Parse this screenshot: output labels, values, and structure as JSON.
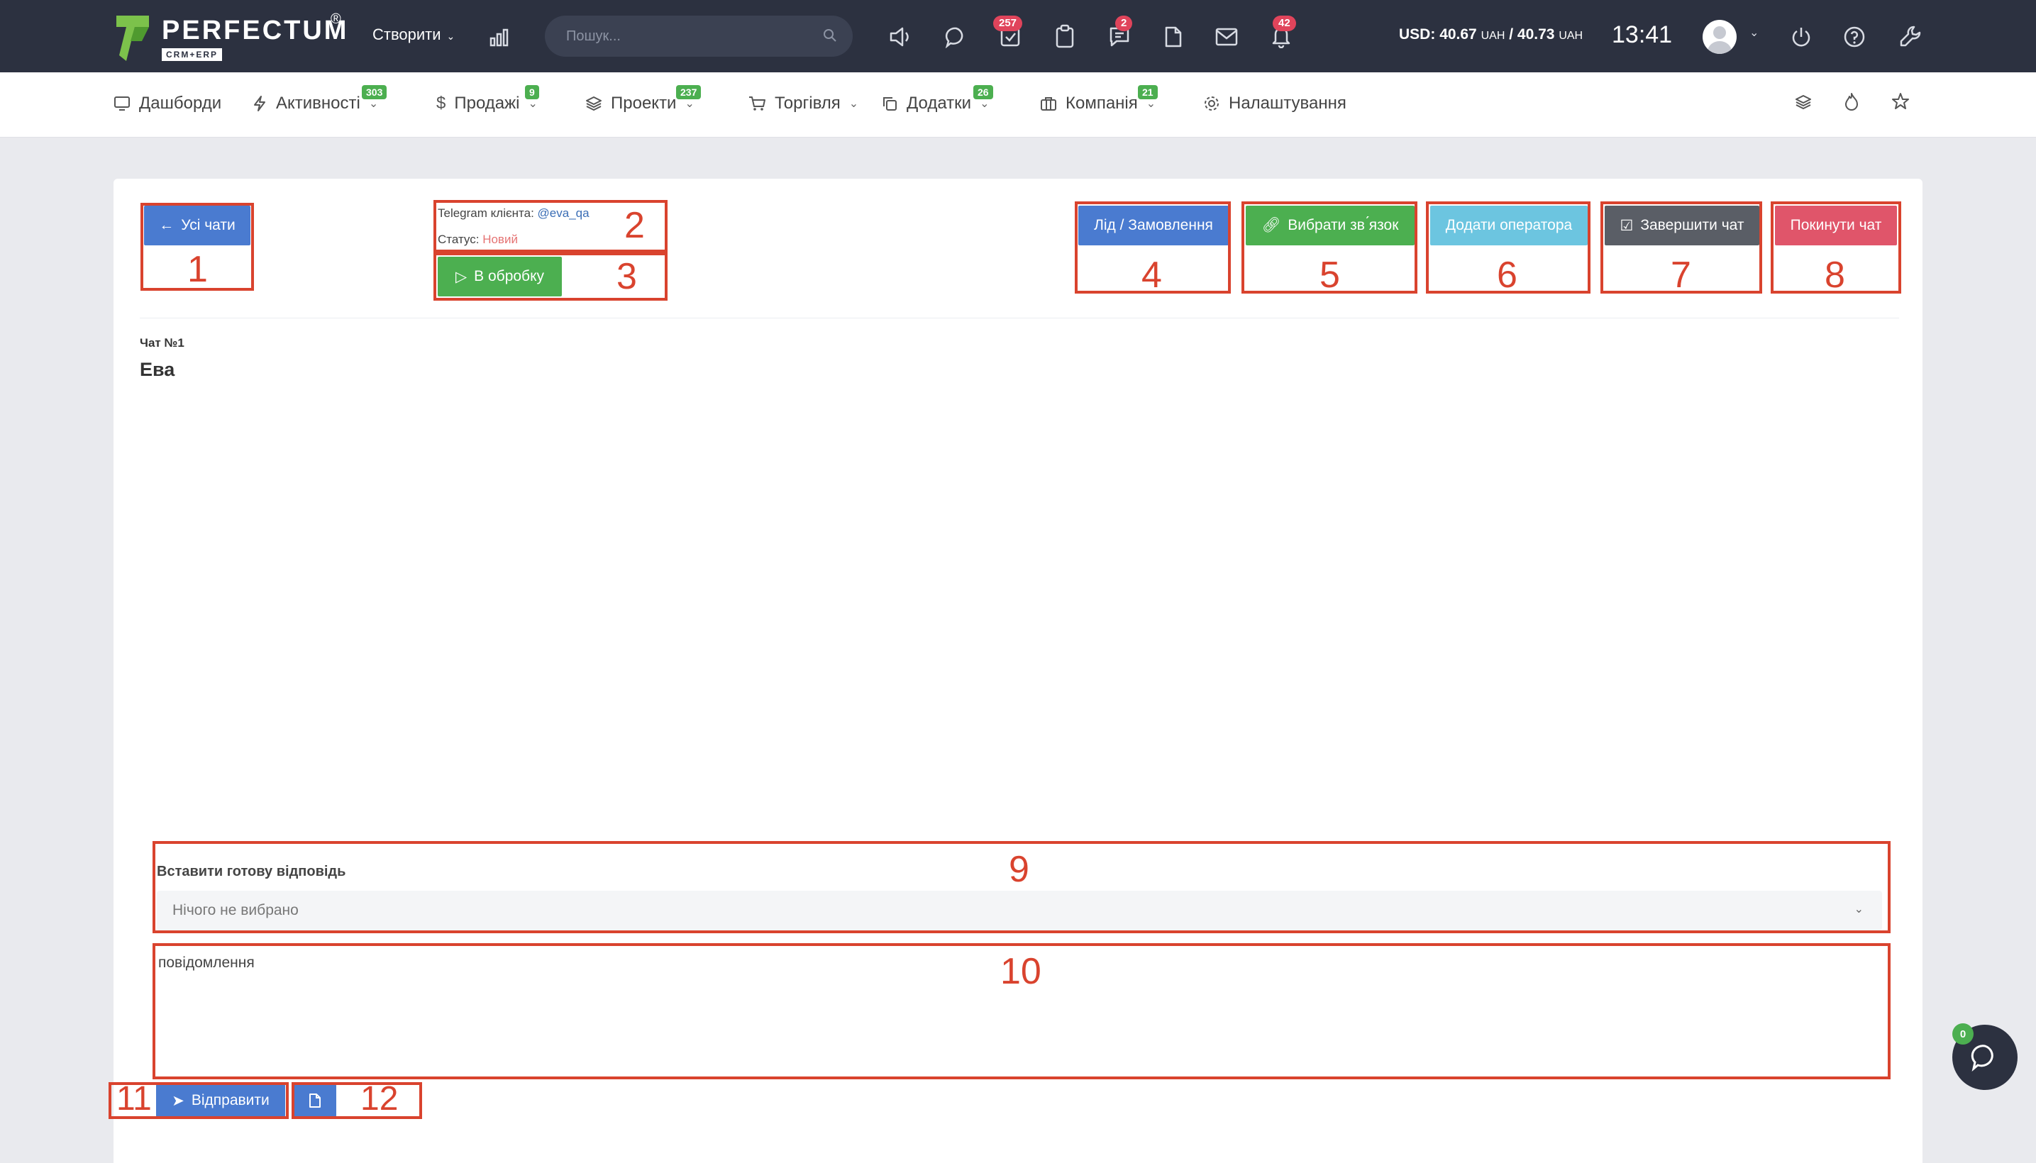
{
  "header": {
    "logo_text": "PERFECTUM",
    "logo_reg": "®",
    "logo_sub": "CRM+ERP",
    "create_label": "Створити",
    "search_placeholder": "Пошук...",
    "badges": {
      "tasks": "257",
      "messages": "2",
      "notifications": "42"
    },
    "currency_prefix": "USD:",
    "rate_buy": "40.67",
    "rate_sell": "40.73",
    "currency_unit": "UAH",
    "currency_sep": "/",
    "time": "13:41"
  },
  "nav": {
    "items": [
      {
        "label": "Дашборди",
        "icon": "monitor-icon"
      },
      {
        "label": "Активності",
        "badge": "303",
        "icon": "bolt-icon"
      },
      {
        "label": "Продажі",
        "badge": "9",
        "icon": "dollar-icon"
      },
      {
        "label": "Проекти",
        "badge": "237",
        "icon": "layers-icon"
      },
      {
        "label": "Торгівля",
        "icon": "cart-icon"
      },
      {
        "label": "Додатки",
        "badge": "26",
        "icon": "copy-icon"
      },
      {
        "label": "Компанія",
        "badge": "21",
        "icon": "briefcase-icon"
      },
      {
        "label": "Налаштування",
        "icon": "gear-icon"
      }
    ]
  },
  "chat": {
    "all_chats_label": "Усі чати",
    "telegram_label": "Telegram клієнта:",
    "telegram_handle": "@eva_qa",
    "status_label": "Статус:",
    "status_value": "Новий",
    "process_label": "В обробку",
    "lead_order_label": "Лід / Замовлення",
    "link_label": "Вибрати зв ́язок",
    "add_operator_label": "Додати оператора",
    "finish_chat_label": "Завершити чат",
    "leave_chat_label": "Покинути чат",
    "chat_number": "Чат №1",
    "chat_name": "Ева",
    "ready_answer_label": "Вставити готову відповідь",
    "select_value": "Нічого не вибрано",
    "message_placeholder": "повідомлення",
    "send_label": "Відправити",
    "fab_badge": "0"
  },
  "annotations": [
    "1",
    "2",
    "3",
    "4",
    "5",
    "6",
    "7",
    "8",
    "9",
    "10",
    "11",
    "12"
  ],
  "colors": {
    "header_bg": "#2c3140",
    "primary": "#4a7bd0",
    "success": "#4caf50",
    "info": "#6cc5e0",
    "dark": "#5a5e66",
    "danger": "#e0556a",
    "annotation": "#d9432e"
  }
}
